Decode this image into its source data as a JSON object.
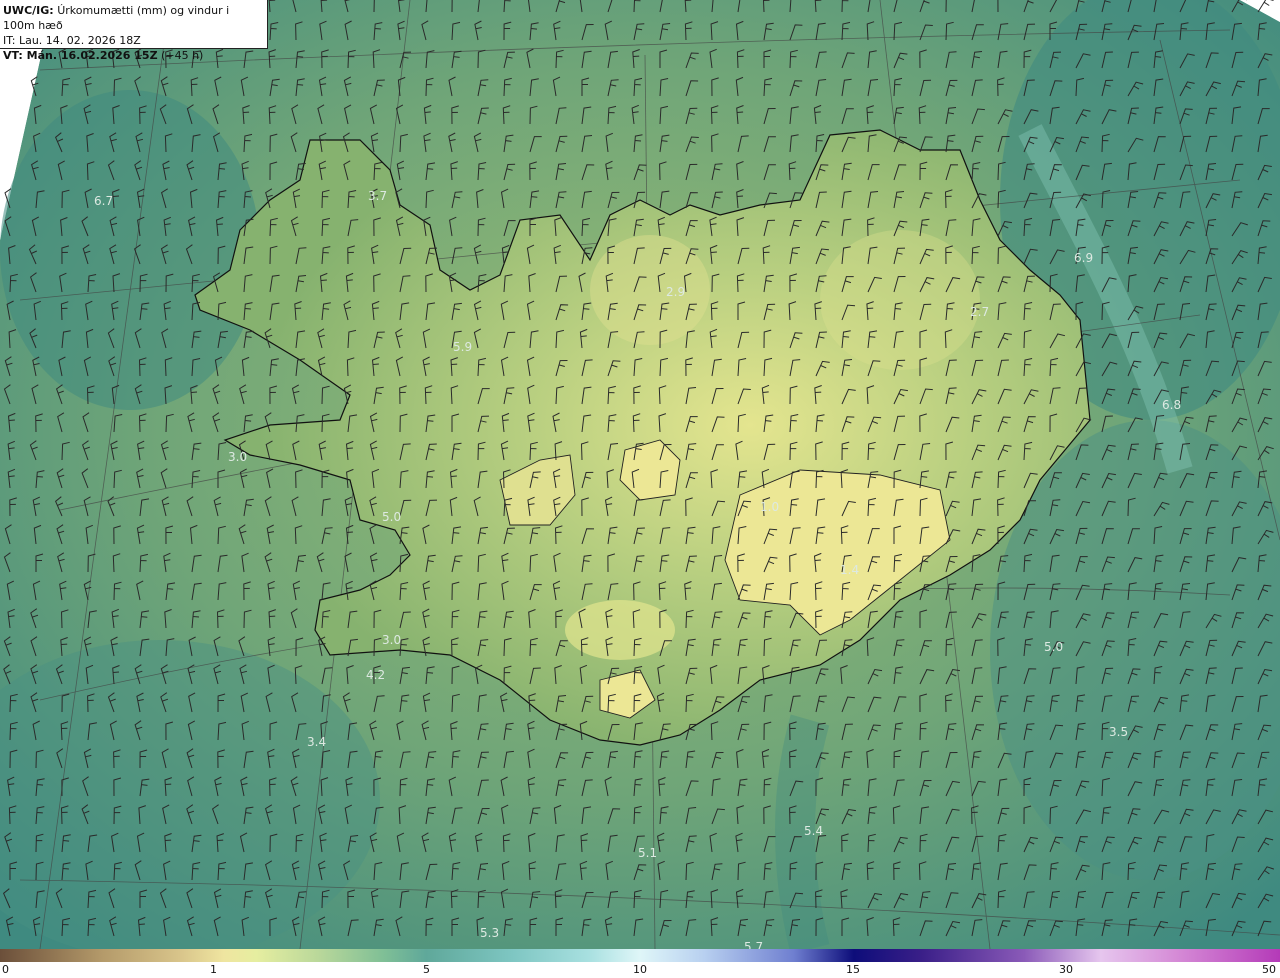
{
  "title": {
    "product": "UWC/IG:",
    "description": "Úrkomumætti (mm) og vindur i 100m hæð",
    "issue_time": "IT: Lau. 14. 02. 2026 18Z",
    "valid_time_label": "VT: Mán. 16.02.2026 15Z",
    "valid_time_lead": "(+45 h)"
  },
  "value_labels": [
    "6.7",
    "3.7",
    "5.9",
    "2.9",
    "5.0",
    "3.0",
    "4.2",
    "3.4",
    "3.0",
    "1.0",
    "1.4",
    "6.9",
    "2.7",
    "6.8",
    "5.0",
    "3.5",
    "5.4",
    "5.1",
    "5.3",
    "5.7"
  ],
  "colorbar": {
    "ticks": [
      "0",
      "1",
      "5",
      "10",
      "15",
      "30",
      "50"
    ],
    "tick_fractions": [
      0.0,
      0.166,
      0.333,
      0.5,
      0.666,
      0.833,
      1.0
    ]
  },
  "colors": {
    "sea_dark": "#3f8a80",
    "sea_mid": "#5f9d7c",
    "land": "#8db86f",
    "highland": "#dbe08c",
    "coastline": "#111111",
    "label": "#d8e8e0"
  }
}
